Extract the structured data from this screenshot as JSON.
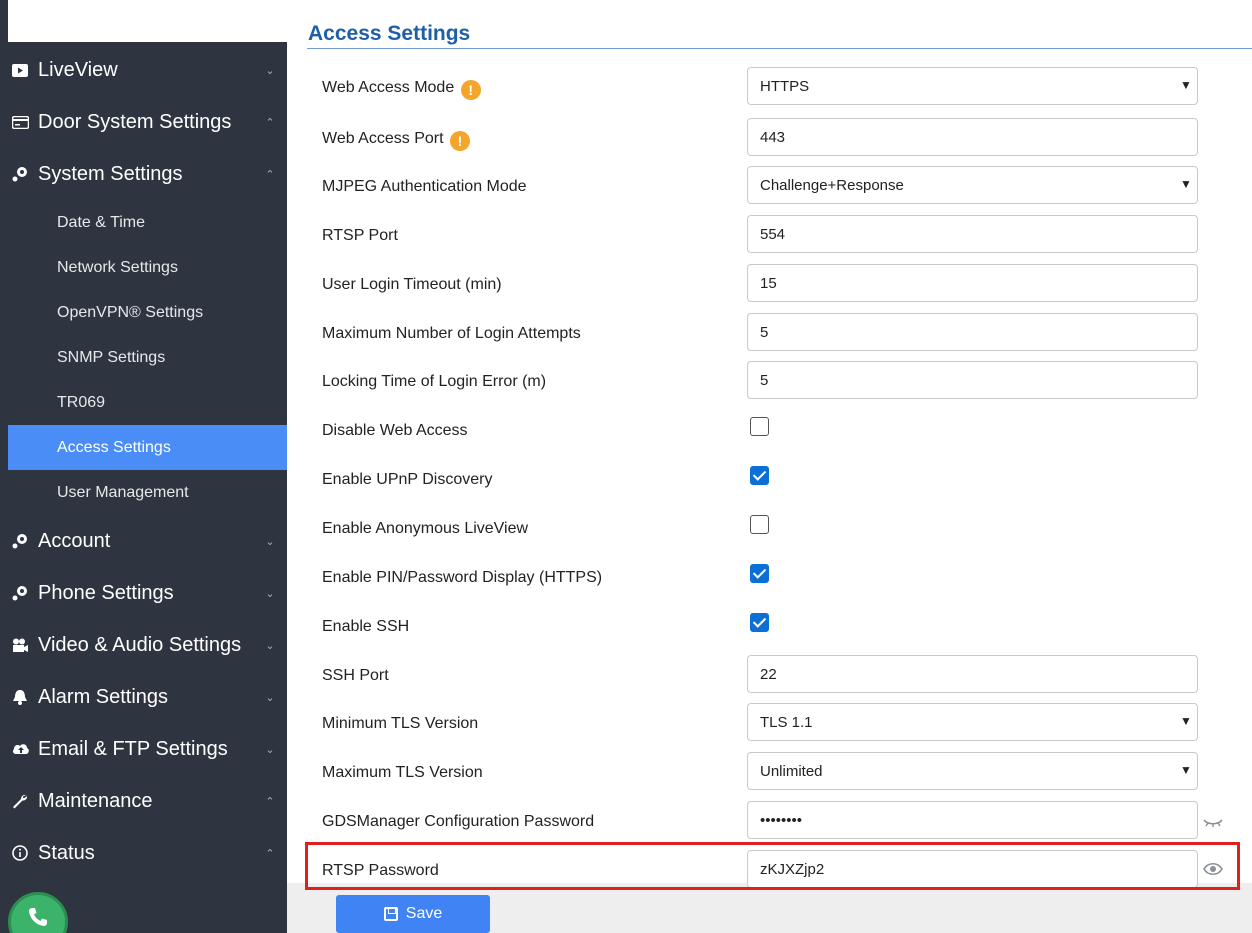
{
  "colors": {
    "sidebar_bg": "#2e3440",
    "active_item": "#4a8df6",
    "title": "#1f5fa8",
    "checkbox_checked": "#0b6fd6",
    "highlight_border": "#e0201f",
    "save_button": "#3f83f4"
  },
  "sidebar": {
    "items": [
      {
        "label": "LiveView",
        "icon": "video-icon",
        "chevron": "⌄"
      },
      {
        "label": "Door System Settings",
        "icon": "door-settings-icon",
        "chevron": "⌃"
      },
      {
        "label": "System Settings",
        "icon": "gear-icon",
        "chevron": "⌃"
      },
      {
        "label": "Account",
        "icon": "gear-icon",
        "chevron": "⌄"
      },
      {
        "label": "Phone Settings",
        "icon": "gear-icon",
        "chevron": "⌄"
      },
      {
        "label": "Video & Audio Settings",
        "icon": "camera-icon",
        "chevron": "⌄"
      },
      {
        "label": "Alarm Settings",
        "icon": "bell-icon",
        "chevron": "⌄"
      },
      {
        "label": "Email & FTP Settings",
        "icon": "cloud-upload-icon",
        "chevron": "⌄"
      },
      {
        "label": "Maintenance",
        "icon": "wrench-icon",
        "chevron": "⌃"
      },
      {
        "label": "Status",
        "icon": "info-icon",
        "chevron": "⌃"
      }
    ],
    "subitems": [
      "Date & Time",
      "Network Settings",
      "OpenVPN® Settings",
      "SNMP Settings",
      "TR069",
      "Access Settings",
      "User Management"
    ],
    "active_subitem": "Access Settings"
  },
  "main": {
    "title": "Access Settings",
    "fields": {
      "web_access_mode": {
        "label": "Web Access Mode",
        "value": "HTTPS"
      },
      "web_access_port": {
        "label": "Web Access Port",
        "value": "443"
      },
      "mjpeg_auth_mode": {
        "label": "MJPEG Authentication Mode",
        "value": "Challenge+Response"
      },
      "rtsp_port": {
        "label": "RTSP Port",
        "value": "554"
      },
      "login_timeout": {
        "label": "User Login Timeout (min)",
        "value": "15"
      },
      "max_login_attempts": {
        "label": "Maximum Number of Login Attempts",
        "value": "5"
      },
      "locking_time": {
        "label": "Locking Time of Login Error (m)",
        "value": "5"
      },
      "disable_web_access": {
        "label": "Disable Web Access",
        "checked": false
      },
      "enable_upnp": {
        "label": "Enable UPnP Discovery",
        "checked": true
      },
      "enable_anon_liveview": {
        "label": "Enable Anonymous LiveView",
        "checked": false
      },
      "enable_pin_display": {
        "label": "Enable PIN/Password Display (HTTPS)",
        "checked": true
      },
      "enable_ssh": {
        "label": "Enable SSH",
        "checked": true
      },
      "ssh_port": {
        "label": "SSH Port",
        "value": "22"
      },
      "min_tls": {
        "label": "Minimum TLS Version",
        "value": "TLS 1.1"
      },
      "max_tls": {
        "label": "Maximum TLS Version",
        "value": "Unlimited"
      },
      "gds_password": {
        "label": "GDSManager Configuration Password",
        "value": "••••••••"
      },
      "rtsp_password": {
        "label": "RTSP Password",
        "value": "zKJXZjp2"
      }
    }
  },
  "footer": {
    "save_label": "Save"
  }
}
